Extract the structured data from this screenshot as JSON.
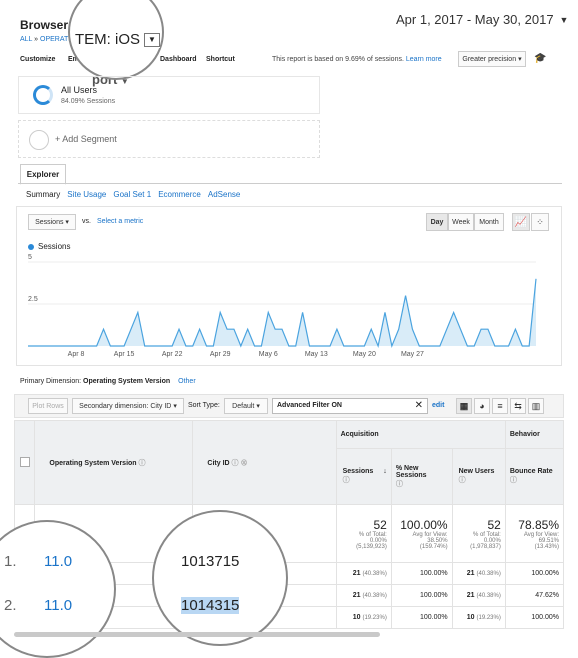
{
  "header": {
    "title": "Browser &",
    "breadcrumb_all": "ALL",
    "breadcrumb_sep": "»",
    "breadcrumb_item": "OPERATI",
    "magnified_label": "TEM: iOS",
    "date_range": "Apr 1, 2017 - May 30, 2017"
  },
  "toolbar": {
    "customize": "Customize",
    "email": "Em",
    "dashboard": "Dashboard",
    "shortcut": "Shortcut",
    "report_text": "This report is based on 9.69% of sessions.",
    "learn_more": "Learn more",
    "precision": "Greater precision",
    "behind_report": "port"
  },
  "segments": {
    "all_users": "All Users",
    "all_users_pct": "84.09% Sessions",
    "add_segment": "+ Add Segment"
  },
  "tabs": {
    "explorer": "Explorer",
    "subtabs": [
      "Summary",
      "Site Usage",
      "Goal Set 1",
      "Ecommerce",
      "AdSense"
    ]
  },
  "chart_controls": {
    "metric": "Sessions",
    "vs": "vs.",
    "select_metric": "Select a metric",
    "day": "Day",
    "week": "Week",
    "month": "Month"
  },
  "chart_data": {
    "type": "area",
    "series": [
      {
        "name": "Sessions",
        "values": [
          0,
          0,
          0,
          0,
          0,
          0,
          0,
          0,
          0,
          0,
          0,
          1,
          0,
          0,
          0,
          1,
          2,
          0,
          0,
          0,
          0,
          0,
          1,
          0,
          0,
          1,
          0,
          0,
          2,
          1,
          1,
          0,
          1,
          0,
          0,
          2,
          1,
          1,
          0,
          0,
          2,
          0,
          0,
          0,
          0,
          1,
          0,
          0,
          0,
          0,
          1,
          0,
          2,
          0,
          1,
          3,
          1,
          0,
          0,
          0,
          0,
          1,
          2,
          1,
          0,
          0,
          1,
          1,
          0,
          0,
          0,
          1,
          0,
          0,
          4
        ]
      }
    ],
    "x_tick_labels": [
      "Apr 8",
      "Apr 15",
      "Apr 22",
      "Apr 29",
      "May 6",
      "May 13",
      "May 20",
      "May 27"
    ],
    "y_tick_labels": [
      "5",
      "2.5"
    ],
    "ylim": [
      0,
      5
    ]
  },
  "dimensions": {
    "primary_label": "Primary Dimension:",
    "primary_value": "Operating System Version",
    "other": "Other",
    "plot_rows": "Plot Rows",
    "secondary": "Secondary dimension: City ID",
    "sort_label": "Sort Type:",
    "sort_value": "Default",
    "filter_text": "Advanced Filter ON",
    "edit": "edit"
  },
  "table": {
    "group_acquisition": "Acquisition",
    "group_behavior": "Behavior",
    "col_os": "Operating System Version",
    "col_city": "City ID",
    "col_sessions": "Sessions",
    "col_new_sessions": "% New Sessions",
    "col_new_users": "New Users",
    "col_bounce": "Bounce Rate",
    "totals": {
      "sessions": "52",
      "sessions_sub1": "% of Total:",
      "sessions_sub2": "0.00%",
      "sessions_sub3": "(5,139,923)",
      "new_sessions": "100.00%",
      "new_sessions_sub1": "Avg for View:",
      "new_sessions_sub2": "38.50%",
      "new_sessions_sub3": "(159.74%)",
      "new_users": "52",
      "new_users_sub1": "% of Total:",
      "new_users_sub2": "0.00%",
      "new_users_sub3": "(1,978,837)",
      "bounce": "78.85%",
      "bounce_sub1": "Avg for View:",
      "bounce_sub2": "69.51%",
      "bounce_sub3": "(13.43%)"
    },
    "rows": [
      {
        "index": "1.",
        "os": "11.0",
        "city": "1013715",
        "sessions": "21",
        "sessions_pct": "(40.38%)",
        "new_sessions": "100.00%",
        "new_users": "21",
        "new_users_pct": "(40.38%)",
        "bounce": "100.00%"
      },
      {
        "index": "2.",
        "os": "11.0",
        "city": "1014315",
        "sessions": "21",
        "sessions_pct": "(40.38%)",
        "new_sessions": "100.00%",
        "new_users": "21",
        "new_users_pct": "(40.38%)",
        "bounce": "47.62%"
      },
      {
        "index": "",
        "os": "",
        "city": "",
        "sessions": "10",
        "sessions_pct": "(19.23%)",
        "new_sessions": "100.00%",
        "new_users": "10",
        "new_users_pct": "(19.23%)",
        "bounce": "100.00%"
      }
    ]
  },
  "colors": {
    "accent": "#1a73c8",
    "chart_line": "#4aa3df",
    "chart_fill": "#d9ecf8"
  }
}
